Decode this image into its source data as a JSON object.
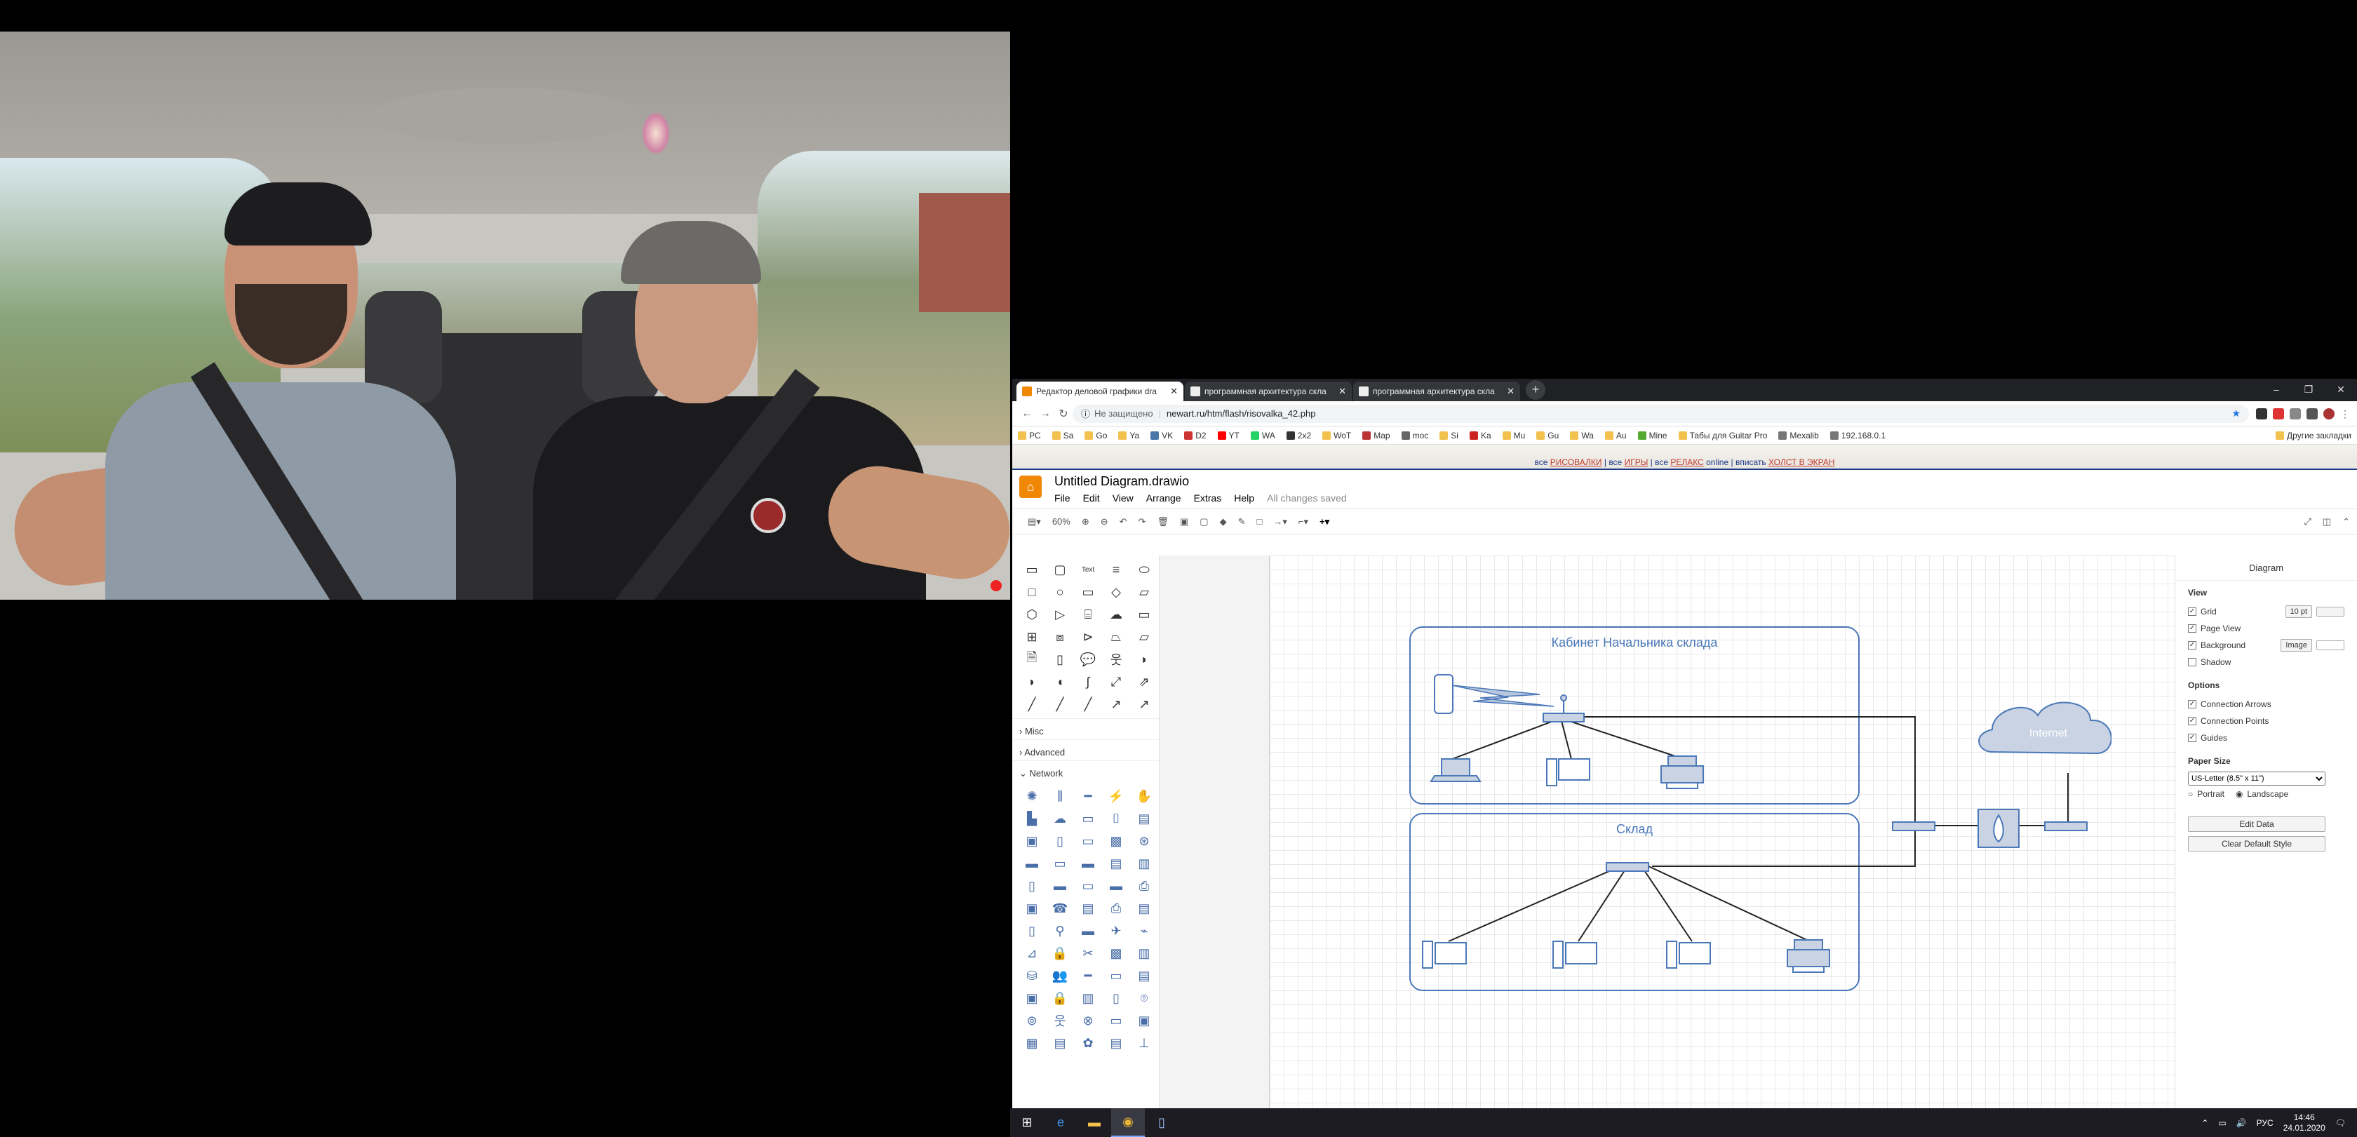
{
  "browser": {
    "tabs": [
      {
        "label": "Редактор деловой графики dra",
        "active": true
      },
      {
        "label": "программная архитектура скла",
        "active": false
      },
      {
        "label": "программная архитектура скла",
        "active": false
      }
    ],
    "new_tab": "+",
    "security_label": "Не защищено",
    "url": "newart.ru/htm/flash/risovalka_42.php",
    "bookmarks": [
      "PC",
      "Sa",
      "Go",
      "Ya",
      "VK",
      "D2",
      "YT",
      "WA",
      "2x2",
      "WoT",
      "Map",
      "moc",
      "Si",
      "Ka",
      "Mu",
      "Gu",
      "Wa",
      "Au",
      "Mine",
      "Табы для Guitar Pro",
      "Mexalib",
      "192.168.0.1",
      "Другие закладки"
    ]
  },
  "site_banner": {
    "all1": "все ",
    "link1": "РИСОВАЛКИ",
    "all2": " | все ",
    "link2": "ИГРЫ",
    "all3": " | все ",
    "link3": "РЕЛАКС",
    "online": " online | вписать ",
    "link4": "ХОЛСТ В ЭКРАН"
  },
  "drawio": {
    "title": "Untitled Diagram.drawio",
    "menu": [
      "File",
      "Edit",
      "View",
      "Arrange",
      "Extras",
      "Help"
    ],
    "saved_status": "All changes saved",
    "zoom": "60%",
    "text_shape_label": "Text",
    "sections": {
      "misc": "Misc",
      "advanced": "Advanced",
      "network": "Network"
    },
    "diagram": {
      "room1": "Кабинет Начальника склада",
      "room2": "Склад",
      "cloud": "Internet"
    },
    "format_panel": {
      "title": "Diagram",
      "view_heading": "View",
      "grid": "Grid",
      "grid_size": "10 pt",
      "page_view": "Page View",
      "background": "Background",
      "image_button": "Image",
      "shadow": "Shadow",
      "options_heading": "Options",
      "connection_arrows": "Connection Arrows",
      "connection_points": "Connection Points",
      "guides": "Guides",
      "paper_size_heading": "Paper Size",
      "paper_size": "US-Letter (8.5\" x 11\")",
      "portrait": "Portrait",
      "landscape": "Landscape",
      "edit_data": "Edit Data",
      "clear_default_style": "Clear Default Style"
    }
  },
  "taskbar": {
    "language": "РУС",
    "time": "14:46",
    "date": "24.01.2020"
  },
  "colors": {
    "diagram_stroke": "#4a78b8",
    "drawio_orange": "#f08705",
    "cloud_fill": "#c9d3e3"
  }
}
